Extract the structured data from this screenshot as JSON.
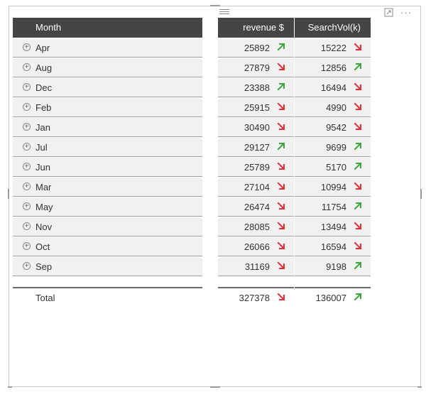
{
  "colors": {
    "header_bg": "#454545",
    "row_bg": "#f1f1f1",
    "up": "#3fa33f",
    "down": "#e0303a"
  },
  "table": {
    "headers": {
      "month": "Month",
      "revenue": "revenue $",
      "searchvol": "SearchVol(k)"
    },
    "rows": [
      {
        "month": "Apr",
        "revenue": "25892",
        "revenue_trend": "up",
        "searchvol": "15222",
        "searchvol_trend": "down"
      },
      {
        "month": "Aug",
        "revenue": "27879",
        "revenue_trend": "down",
        "searchvol": "12856",
        "searchvol_trend": "up"
      },
      {
        "month": "Dec",
        "revenue": "23388",
        "revenue_trend": "up",
        "searchvol": "16494",
        "searchvol_trend": "down"
      },
      {
        "month": "Feb",
        "revenue": "25915",
        "revenue_trend": "down",
        "searchvol": "4990",
        "searchvol_trend": "down"
      },
      {
        "month": "Jan",
        "revenue": "30490",
        "revenue_trend": "down",
        "searchvol": "9542",
        "searchvol_trend": "down"
      },
      {
        "month": "Jul",
        "revenue": "29127",
        "revenue_trend": "up",
        "searchvol": "9699",
        "searchvol_trend": "up"
      },
      {
        "month": "Jun",
        "revenue": "25789",
        "revenue_trend": "down",
        "searchvol": "5170",
        "searchvol_trend": "up"
      },
      {
        "month": "Mar",
        "revenue": "27104",
        "revenue_trend": "down",
        "searchvol": "10994",
        "searchvol_trend": "down"
      },
      {
        "month": "May",
        "revenue": "26474",
        "revenue_trend": "down",
        "searchvol": "11754",
        "searchvol_trend": "up"
      },
      {
        "month": "Nov",
        "revenue": "28085",
        "revenue_trend": "down",
        "searchvol": "13494",
        "searchvol_trend": "down"
      },
      {
        "month": "Oct",
        "revenue": "26066",
        "revenue_trend": "down",
        "searchvol": "16594",
        "searchvol_trend": "down"
      },
      {
        "month": "Sep",
        "revenue": "31169",
        "revenue_trend": "down",
        "searchvol": "9198",
        "searchvol_trend": "up"
      }
    ],
    "total": {
      "label": "Total",
      "revenue": "327378",
      "revenue_trend": "down",
      "searchvol": "136007",
      "searchvol_trend": "up"
    }
  },
  "toolbar": {
    "focus_icon": "focus-mode-icon",
    "more_icon": "more-options-icon"
  }
}
